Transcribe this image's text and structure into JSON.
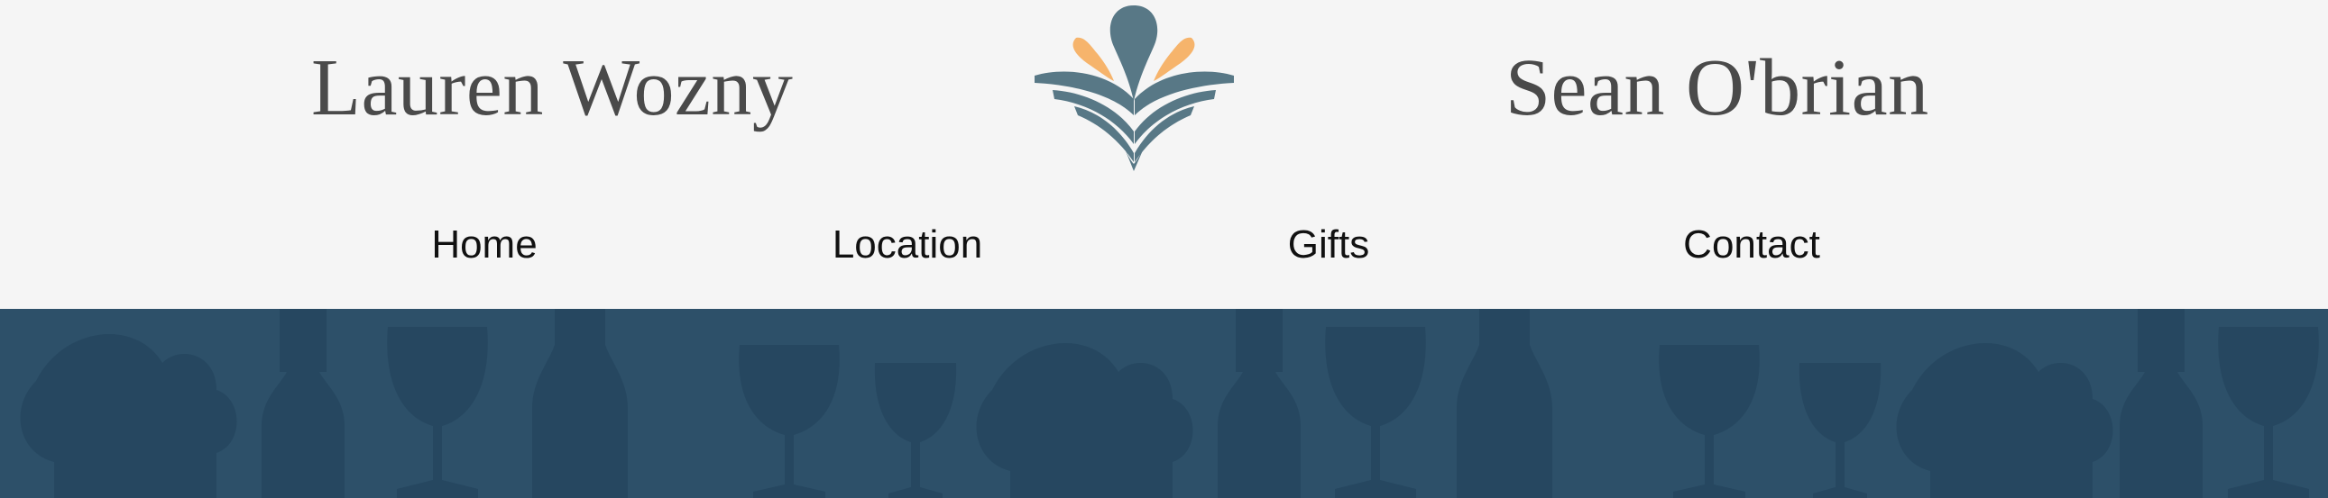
{
  "header": {
    "name_left": "Lauren Wozny",
    "name_right": "Sean O'brian",
    "logo_icon": "floral-book-logo-icon"
  },
  "nav": {
    "items": [
      {
        "label": "Home"
      },
      {
        "label": "Location"
      },
      {
        "label": "Gifts"
      },
      {
        "label": "Contact"
      }
    ]
  },
  "banner": {
    "pattern": "grape-leaf-wine-bottle-wine-glass-silhouettes"
  },
  "colors": {
    "background": "#f5f5f5",
    "name_text": "#4a4a4a",
    "nav_text": "#111111",
    "logo_teal": "#587886",
    "logo_orange": "#f6b46c",
    "banner_bg": "#2d5069",
    "banner_silhouette": "#264760"
  }
}
